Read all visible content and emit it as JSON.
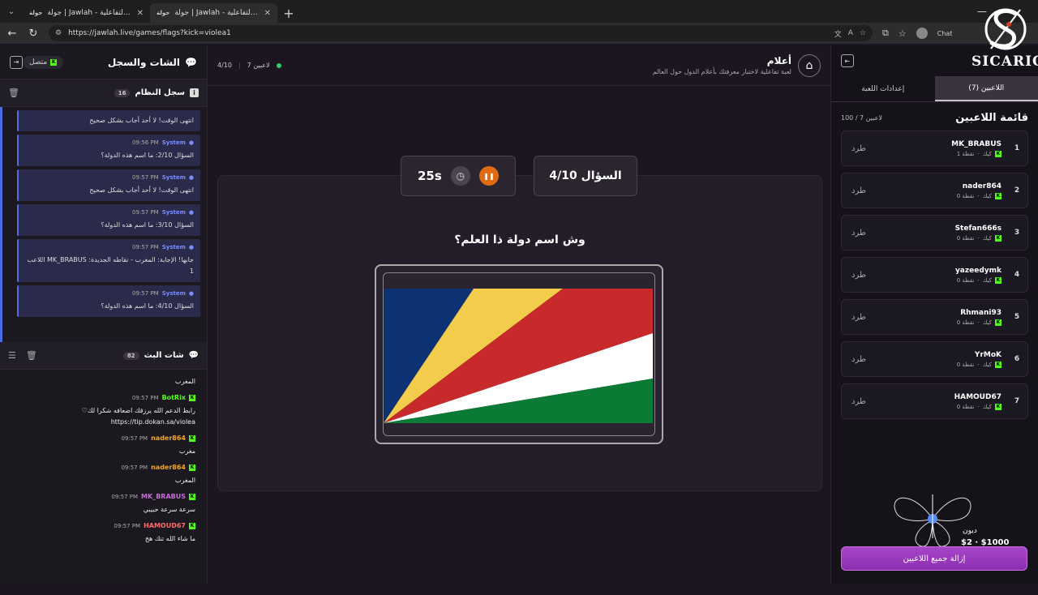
{
  "browser": {
    "tabs": [
      {
        "favicon": "جولة",
        "title": "جولة | Jawlah - منصة الألعاب التفاعلية",
        "active": false
      },
      {
        "favicon": "جولة",
        "title": "جولة | Jawlah - منصة الألعاب التفاعلية",
        "active": true
      }
    ],
    "url": "https://jawlah.live/games/flags?kick=violea1",
    "profile_text": "Chat"
  },
  "watermark": {
    "text": "SICARIO"
  },
  "header": {
    "game_name": "أعلام",
    "game_desc": "لعبة تفاعلية لاختبار معرفتك بأعلام الدول حول العالم",
    "players_online": "7 لاعبين",
    "question_progress": "4/10"
  },
  "game": {
    "question_label": "السؤال 4/10",
    "timer": "25s",
    "question": "وش اسم دولة ذا العلم؟",
    "flag_colors": [
      "#0d3273",
      "#f2cc4a",
      "#c8292a",
      "#ffffff",
      "#0a7a35"
    ]
  },
  "chat_panel": {
    "title": "الشات والسجل",
    "status": "متصل",
    "system_log": {
      "title": "سجل النظام",
      "count": "16",
      "messages": [
        {
          "sender": "",
          "time": "",
          "text": "انتهى الوقت! لا أحد أجاب بشكل صحيح"
        },
        {
          "sender": "System",
          "time": "09:56 PM",
          "text": "السؤال 2/10: ما اسم هذه الدولة؟"
        },
        {
          "sender": "System",
          "time": "09:57 PM",
          "text": "انتهى الوقت! لا أحد أجاب بشكل صحيح"
        },
        {
          "sender": "System",
          "time": "09:57 PM",
          "text": "السؤال 3/10: ما اسم هذه الدولة؟"
        },
        {
          "sender": "System",
          "time": "09:57 PM",
          "text": "اللاعب MK_BRABUS جابها! الإجابة: المغرب - نقاطه الجديدة: 1"
        },
        {
          "sender": "System",
          "time": "09:57 PM",
          "text": "السؤال 4/10: ما اسم هذه الدولة؟"
        }
      ]
    },
    "stream_chat": {
      "title": "شات البث",
      "count": "82",
      "messages": [
        {
          "user": "",
          "color": "#ffffff",
          "time": "",
          "text": "المغرب"
        },
        {
          "user": "BotRix",
          "color": "#53fc18",
          "time": "09:57 PM",
          "text": "♡رابط الدعم الله يرزقك اضعافه شكرا لك https://tip.dokan.sa/violea"
        },
        {
          "user": "nader864",
          "color": "#f5a623",
          "time": "09:57 PM",
          "text": "مغرب"
        },
        {
          "user": "nader864",
          "color": "#f5a623",
          "time": "09:57 PM",
          "text": "المغرب"
        },
        {
          "user": "MK_BRABUS",
          "color": "#c86dd7",
          "time": "09:57 PM",
          "text": "سرعة سرعة حبيبي"
        },
        {
          "user": "HAMOUD67",
          "color": "#ff6b6b",
          "time": "09:57 PM",
          "text": "ما شاء الله تنك هخ"
        }
      ]
    }
  },
  "players_panel": {
    "tabs": [
      "اللاعبين (7)",
      "إعدادات اللعبة"
    ],
    "list_title": "قائمة اللاعبين",
    "list_count": "100 / 7 لاعبين",
    "kick_label": "طرد",
    "platform_label": "كيك",
    "players": [
      {
        "rank": "1",
        "name": "MK_BRABUS",
        "points": "1 نقطة"
      },
      {
        "rank": "2",
        "name": "nader864",
        "points": "0 نقطة"
      },
      {
        "rank": "3",
        "name": "Stefan666s",
        "points": "0 نقطة"
      },
      {
        "rank": "4",
        "name": "yazeedymk",
        "points": "0 نقطة"
      },
      {
        "rank": "5",
        "name": "Rhmani93",
        "points": "0 نقطة"
      },
      {
        "rank": "6",
        "name": "YrMoK",
        "points": "0 نقطة"
      },
      {
        "rank": "7",
        "name": "HAMOUD67",
        "points": "0 نقطة"
      }
    ],
    "donation": {
      "name": "ديون",
      "amount": "$2 · $1000"
    },
    "remove_all_label": "إزالة جميع اللاعبين"
  }
}
